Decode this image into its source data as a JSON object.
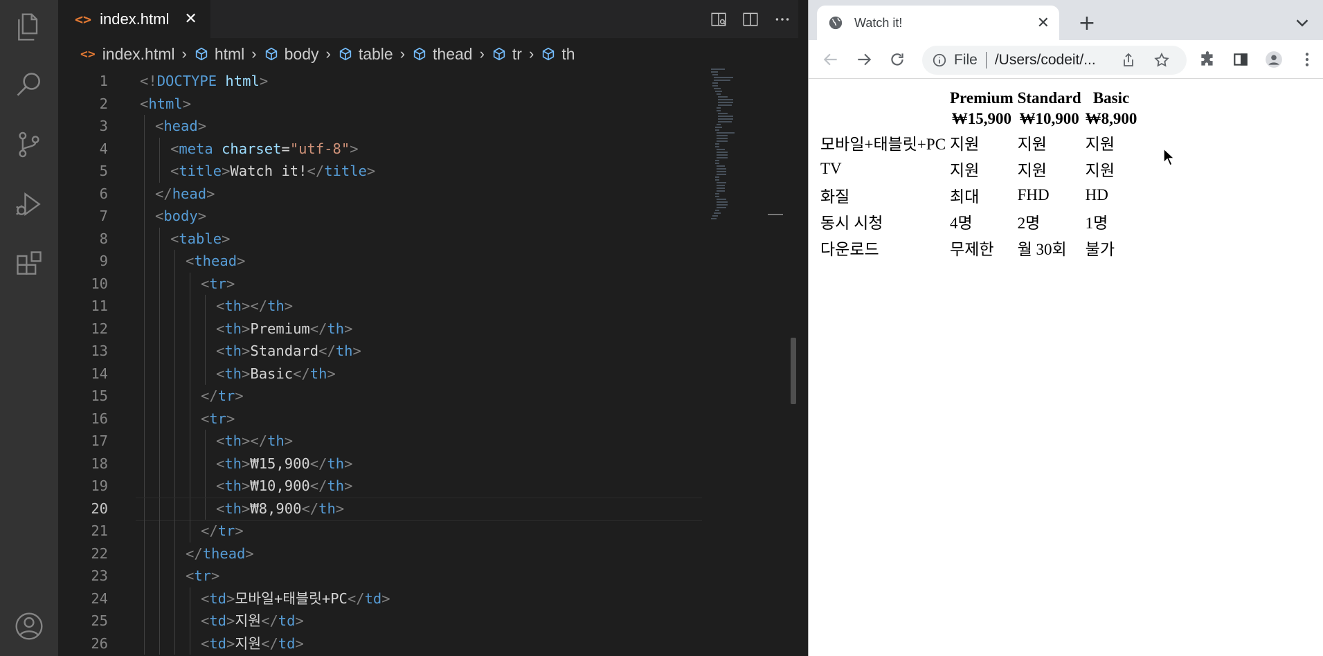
{
  "editor": {
    "tab": {
      "label": "index.html",
      "icon": "html-file-icon",
      "close": "✕"
    },
    "breadcrumb": [
      "index.html",
      "html",
      "body",
      "table",
      "thead",
      "tr",
      "th"
    ],
    "lines": [
      {
        "num": "1"
      },
      {
        "num": "2"
      },
      {
        "num": "3"
      },
      {
        "num": "4"
      },
      {
        "num": "5"
      },
      {
        "num": "6"
      },
      {
        "num": "7"
      },
      {
        "num": "8"
      },
      {
        "num": "9"
      },
      {
        "num": "10"
      },
      {
        "num": "11"
      },
      {
        "num": "12"
      },
      {
        "num": "13"
      },
      {
        "num": "14"
      },
      {
        "num": "15"
      },
      {
        "num": "16"
      },
      {
        "num": "17"
      },
      {
        "num": "18"
      },
      {
        "num": "19"
      },
      {
        "num": "20"
      },
      {
        "num": "21"
      },
      {
        "num": "22"
      },
      {
        "num": "23"
      },
      {
        "num": "24"
      },
      {
        "num": "25"
      },
      {
        "num": "26"
      }
    ],
    "code": {
      "doctype_open": "<!",
      "doctype_kw": "DOCTYPE",
      "doctype_val": " html",
      "doctype_close": ">",
      "t_html": "html",
      "t_head": "head",
      "t_meta": "meta",
      "a_charset": "charset",
      "v_charset": "\"utf-8\"",
      "t_title": "title",
      "title_text": "Watch it!",
      "t_body": "body",
      "t_table": "table",
      "t_thead": "thead",
      "t_tr": "tr",
      "t_th": "th",
      "t_td": "td",
      "th_premium": "Premium",
      "th_standard": "Standard",
      "th_basic": "Basic",
      "th_p1": "₩15,900",
      "th_p2": "₩10,900",
      "th_p3": "₩8,900",
      "td_mobile": "모바일+태블릿+PC",
      "td_support": "지원",
      "lt": "<",
      "lts": "</",
      "gt": ">",
      "eq": "="
    },
    "active_line": "20",
    "colors": {
      "tag": "#569cd6",
      "attr": "#9cdcfe",
      "string": "#ce9178",
      "text": "#d4d4d4",
      "bracket": "#808080",
      "html_icon": "#e37933"
    }
  },
  "browser": {
    "tab_title": "Watch it!",
    "new_tab": "+",
    "omnibox": {
      "scheme": "File",
      "url": "/Users/codeit/..."
    },
    "table": {
      "header_row1": [
        "",
        "Premium",
        "Standard",
        "Basic"
      ],
      "header_row2": [
        "",
        "₩15,900",
        "₩10,900",
        "₩8,900"
      ],
      "rows": [
        [
          "모바일+태블릿+PC",
          "지원",
          "지원",
          "지원"
        ],
        [
          "TV",
          "지원",
          "지원",
          "지원"
        ],
        [
          "화질",
          "최대",
          "FHD",
          "HD"
        ],
        [
          "동시 시청",
          "4명",
          "2명",
          "1명"
        ],
        [
          "다운로드",
          "무제한",
          "월 30회",
          "불가"
        ]
      ]
    }
  }
}
